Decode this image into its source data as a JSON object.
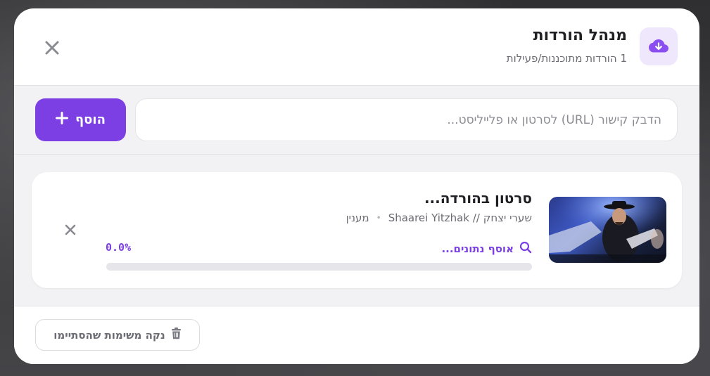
{
  "header": {
    "title": "מנהל הורדות",
    "subtitle": "1 הורדות מתוכננות/פעילות",
    "icon": "cloud-download-icon",
    "close_icon": "close-icon"
  },
  "add_bar": {
    "placeholder": "הדבק קישור (URL) לסרטון או פלייליסט...",
    "value": "",
    "add_label": "הוסף",
    "add_icon": "plus-icon"
  },
  "downloads": [
    {
      "title": "סרטון בהורדה...",
      "channel": "שערי יצחק // Shaarei Yitzhak",
      "separator": "•",
      "tag": "מענין",
      "status": "אוסף נתונים...",
      "status_icon": "search-icon",
      "percent_text": "0.0%",
      "progress": 0.0,
      "thumbnail_icon": "video-thumbnail"
    }
  ],
  "footer": {
    "clear_label": "נקה משימות שהסתיימו",
    "clear_icon": "trash-icon"
  },
  "colors": {
    "accent": "#7b3fe4",
    "accent_light": "#efe8fd",
    "track": "#e6e6ea",
    "section_bg": "#f2f2f4"
  }
}
